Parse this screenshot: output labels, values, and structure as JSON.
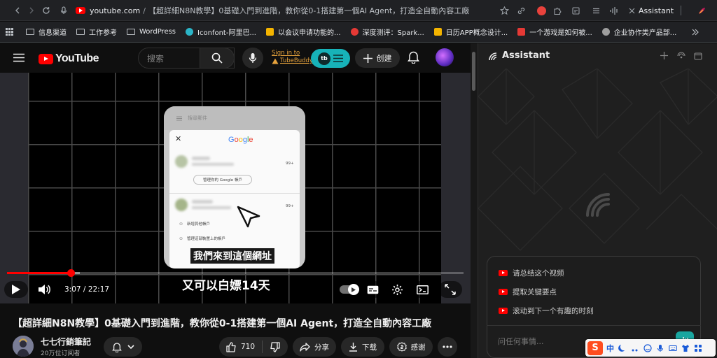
{
  "browser": {
    "url_host": "youtube.com",
    "tab_title": "【超詳細N8N教學】0基礎入門到進階，教你從0-1搭建第一個AI Agent，打造全自動內容工廠",
    "assistant_tab_label": "Assistant"
  },
  "bookmarks": [
    {
      "label": "信息渠道",
      "kind": "folder"
    },
    {
      "label": "工作参考",
      "kind": "folder"
    },
    {
      "label": "WordPress",
      "kind": "folder"
    },
    {
      "label": "Iconfont-阿里巴...",
      "kind": "site",
      "color": "#2bb5c8"
    },
    {
      "label": "以会议申请功能的...",
      "kind": "site",
      "color": "#f4b400"
    },
    {
      "label": "深度测评：Spark...",
      "kind": "site",
      "color": "#e53935"
    },
    {
      "label": "日历APP概念设计...",
      "kind": "site",
      "color": "#f4b400"
    },
    {
      "label": "一个游戏是如何被...",
      "kind": "site",
      "color": "#e53935"
    },
    {
      "label": "企业协作类产品部...",
      "kind": "site",
      "color": "#9e9e9e"
    }
  ],
  "youtube": {
    "logo_text": "YouTube",
    "search_placeholder": "搜索",
    "tubebuddy_line1": "Sign in to",
    "tubebuddy_line2": "TubeBuddy",
    "create_label": "创建"
  },
  "video": {
    "phone_header": "搜尋郵件",
    "google_label": "Google",
    "manage_account": "管理你的 Google 帳戶",
    "count_a": "99+",
    "count_b": "99+",
    "menu_add": "新增其他帳戶",
    "menu_manage": "管理這部裝置上的帳戶",
    "subtitle_line1": "我們來到這個網址",
    "subtitle_line2": "又可以白嫖14天",
    "time_current": "3:07",
    "time_sep": " / ",
    "time_total": "22:17",
    "progress_played": 0.14,
    "progress_loaded": 0.16
  },
  "meta": {
    "title": "【超詳細N8N教學】0基礎入門到進階，教你從0-1搭建第一個AI Agent，打造全自動內容工廠",
    "channel": "七七行銷筆記",
    "subscribers": "20万位订阅者",
    "likes": "710",
    "share": "分享",
    "download": "下载",
    "thanks": "感谢"
  },
  "assistant": {
    "title": "Assistant",
    "prompts": [
      "请总结这个视频",
      "提取关键要点",
      "滚动到下一个有趣的时刻"
    ],
    "input_placeholder": "问任何事情..."
  },
  "ime": {
    "lang": "中"
  },
  "colors": {
    "accent_red": "#ff0000",
    "tubebuddy_teal": "#17b2b8",
    "assistant_send": "#1aa6a0"
  }
}
